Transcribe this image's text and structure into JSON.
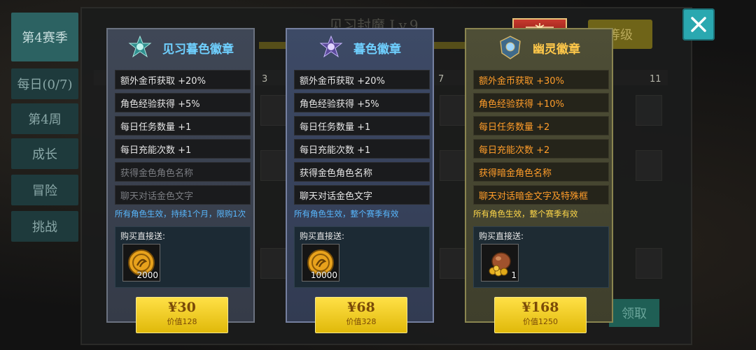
{
  "background": {
    "title": "见习封魔 Lv.9",
    "level_button": "等级",
    "claim_button": "领取",
    "column_numbers": [
      "3",
      "7",
      "11"
    ]
  },
  "nav": {
    "items": [
      {
        "label": "第4赛季"
      },
      {
        "label": "每日(0/7)"
      },
      {
        "label": "第4周"
      },
      {
        "label": "成长"
      },
      {
        "label": "冒险"
      },
      {
        "label": "挑战"
      }
    ]
  },
  "close_icon": "close-icon",
  "cards": [
    {
      "title": "见习暮色徽章",
      "perks": [
        {
          "text": "额外金币获取 +20%"
        },
        {
          "text": "角色经验获得 +5%"
        },
        {
          "text": "每日任务数量 +1"
        },
        {
          "text": "每日充能次数 +1"
        },
        {
          "text": "获得金色角色名称"
        },
        {
          "text": "聊天对话金色文字"
        }
      ],
      "note": "所有角色生效，持续1个月，限购1次",
      "gift_label": "购买直接送:",
      "gift_qty": "2000",
      "gift_icon": "gold-coin-icon",
      "price": "¥30",
      "value": "价值128"
    },
    {
      "title": "暮色徽章",
      "perks": [
        {
          "text": "额外金币获取 +20%"
        },
        {
          "text": "角色经验获得 +5%"
        },
        {
          "text": "每日任务数量 +1"
        },
        {
          "text": "每日充能次数 +1"
        },
        {
          "text": "获得金色角色名称"
        },
        {
          "text": "聊天对话金色文字"
        }
      ],
      "note": "所有角色生效，整个赛季有效",
      "gift_label": "购买直接送:",
      "gift_qty": "10000",
      "gift_icon": "gold-coin-icon",
      "price": "¥68",
      "value": "价值328"
    },
    {
      "title": "幽灵徽章",
      "perks": [
        {
          "text": "额外金币获取 +30%"
        },
        {
          "text": "角色经验获得 +10%"
        },
        {
          "text": "每日任务数量 +2"
        },
        {
          "text": "每日充能次数 +2"
        },
        {
          "text": "获得暗金角色名称"
        },
        {
          "text": "聊天对话暗金文字及特殊框"
        }
      ],
      "note": "所有角色生效，整个赛季有效",
      "gift_label": "购买直接送:",
      "gift_qty": "1",
      "gift_icon": "treasure-bag-icon",
      "price": "¥168",
      "value": "价值1250"
    }
  ],
  "colors": {
    "accent_blue": "#6fd0ff",
    "accent_gold": "#ffc84a",
    "perk_orange": "#ff9d2a",
    "button_yellow": "#ffe046",
    "close_cyan": "#2aa8b0"
  }
}
